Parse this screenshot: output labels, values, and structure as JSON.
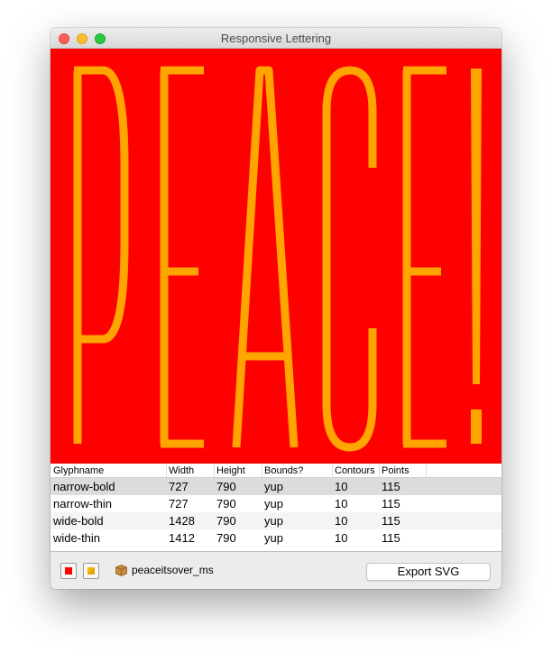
{
  "window": {
    "title": "Responsive Lettering"
  },
  "preview": {
    "text": "PEACE!",
    "background_color": "#ff0000",
    "glyph_color": "#ffa500"
  },
  "table": {
    "columns": [
      "Glyphname",
      "Width",
      "Height",
      "Bounds?",
      "Contours",
      "Points"
    ],
    "rows": [
      {
        "glyphname": "narrow-bold",
        "width": "727",
        "height": "790",
        "bounds": "yup",
        "contours": "10",
        "points": "115",
        "selected": true
      },
      {
        "glyphname": "narrow-thin",
        "width": "727",
        "height": "790",
        "bounds": "yup",
        "contours": "10",
        "points": "115",
        "selected": false
      },
      {
        "glyphname": "wide-bold",
        "width": "1428",
        "height": "790",
        "bounds": "yup",
        "contours": "10",
        "points": "115",
        "selected": false
      },
      {
        "glyphname": "wide-thin",
        "width": "1412",
        "height": "790",
        "bounds": "yup",
        "contours": "10",
        "points": "115",
        "selected": false
      }
    ]
  },
  "bottom": {
    "background_swatch_color": "#ff0000",
    "glyph_swatch_color": "#f5b400",
    "file_icon": "package-icon",
    "file_name": "peaceitsover_ms",
    "export_label": "Export SVG"
  }
}
